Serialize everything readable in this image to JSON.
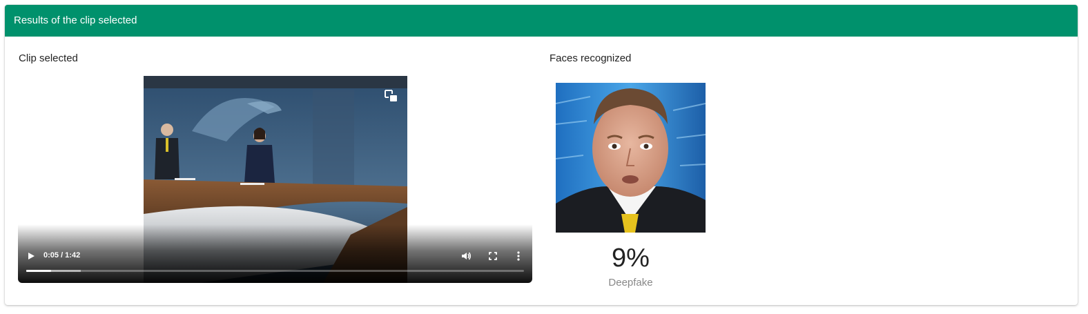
{
  "header": {
    "title": "Results of the clip selected"
  },
  "clip": {
    "title": "Clip selected",
    "player": {
      "time": "0:05 / 1:42",
      "played_fraction": 0.05,
      "icons": {
        "play": "play-icon",
        "volume": "volume-icon",
        "fullscreen": "fullscreen-icon",
        "more": "more-vert-icon",
        "pip": "picture-in-picture-icon"
      }
    }
  },
  "faces": {
    "title": "Faces recognized",
    "items": [
      {
        "score": "9%",
        "label": "Deepfake"
      }
    ]
  },
  "colors": {
    "accent": "#00916c",
    "muted": "#888888"
  }
}
